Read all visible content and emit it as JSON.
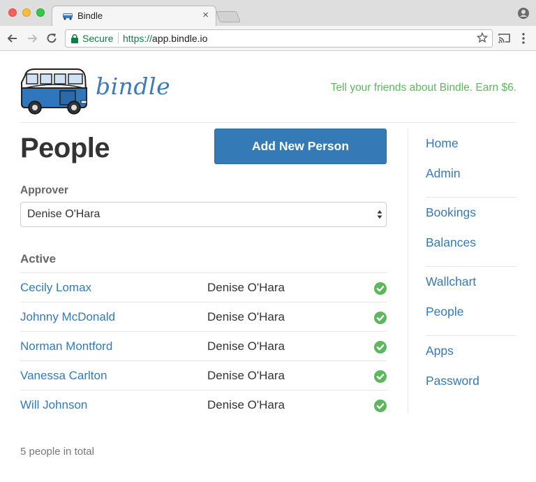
{
  "browser": {
    "tab_title": "Bindle",
    "secure_label": "Secure",
    "url_scheme": "https://",
    "url_host": "app.bindle.io"
  },
  "header": {
    "logo_text": "bindle",
    "promo": "Tell your friends about Bindle. Earn $6."
  },
  "main": {
    "title": "People",
    "add_button": "Add New Person",
    "approver_label": "Approver",
    "approver_value": "Denise O'Hara",
    "active_heading": "Active",
    "people": [
      {
        "name": "Cecily Lomax",
        "approver": "Denise O'Hara"
      },
      {
        "name": "Johnny McDonald",
        "approver": "Denise O'Hara"
      },
      {
        "name": "Norman Montford",
        "approver": "Denise O'Hara"
      },
      {
        "name": "Vanessa Carlton",
        "approver": "Denise O'Hara"
      },
      {
        "name": "Will Johnson",
        "approver": "Denise O'Hara"
      }
    ],
    "total": "5 people in total"
  },
  "sidebar": {
    "groups": [
      [
        "Home",
        "Admin"
      ],
      [
        "Bookings",
        "Balances"
      ],
      [
        "Wallchart",
        "People"
      ],
      [
        "Apps",
        "Password"
      ]
    ]
  },
  "colors": {
    "brand_blue": "#337ab7",
    "promo_green": "#5cb85c",
    "secure_green": "#0b8043"
  }
}
